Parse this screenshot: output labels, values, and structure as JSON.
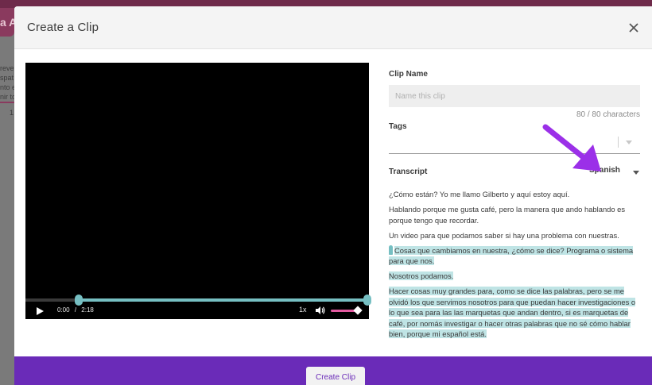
{
  "background": {
    "pill_text": "a A",
    "lines": [
      "reve",
      "spat",
      "nto e",
      "nir to",
      "1"
    ]
  },
  "modal": {
    "title": "Create a Clip",
    "close_icon": "close-icon"
  },
  "player": {
    "current_time": "0:00",
    "separator": "/",
    "duration": "2:18",
    "speed": "1x",
    "icons": {
      "play": "play-icon",
      "volume": "volume-icon"
    },
    "colors": {
      "scrub": "#76bfc2",
      "volume": "#e35aa0"
    }
  },
  "form": {
    "clip_name": {
      "label": "Clip Name",
      "placeholder": "Name this clip",
      "value": "",
      "char_count": "80 / 80 characters"
    },
    "tags": {
      "label": "Tags"
    },
    "transcript": {
      "label": "Transcript",
      "language": "Spanish",
      "lines": [
        "¿Cómo están? Yo me llamo Gilberto y aquí estoy aquí.",
        "Hablando porque me gusta café, pero la manera que ando hablando es porque tengo que recordar.",
        "Un video para que podamos saber si hay una problema con nuestras.",
        "Cosas que cambiamos en nuestra, ¿cómo se dice? Programa o sistema para que nos.",
        "Nosotros podamos.",
        "Hacer cosas muy grandes para, como se dice las palabras, pero se me olvidó los que servimos nosotros para que puedan hacer investigaciones o lo que sea para las las marquetas que andan dentro, si es marquetas de café, por nomás investigar o hacer otras palabras que no sé cómo hablar bien, porque mi español está."
      ]
    }
  },
  "footer": {
    "create_label": "Create Clip",
    "color": "#6a2bb8"
  },
  "annotation": {
    "arrow_color": "#9b30e8",
    "icon": "arrow-icon"
  }
}
